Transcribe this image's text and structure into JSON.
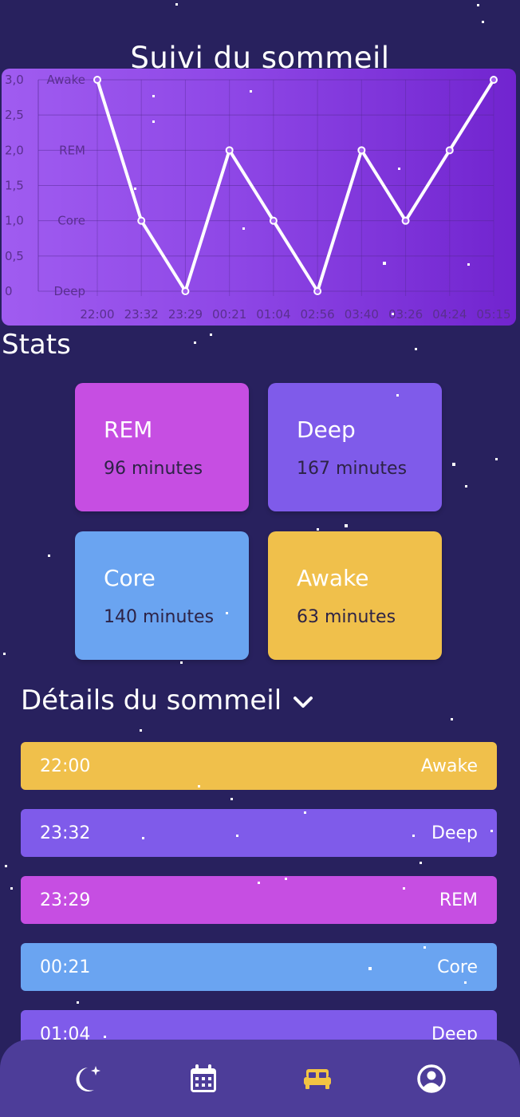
{
  "header": {
    "title": "Suivi du sommeil"
  },
  "chart_data": {
    "type": "line",
    "x": [
      "22:00",
      "23:32",
      "23:29",
      "00:21",
      "01:04",
      "02:56",
      "03:40",
      "03:26",
      "04:24",
      "05:15"
    ],
    "values": [
      3,
      1,
      0,
      2,
      1,
      0,
      2,
      1,
      2,
      3
    ],
    "y_ticks": [
      "0",
      "0,5",
      "1,0",
      "1,5",
      "2,0",
      "2,5",
      "3,0"
    ],
    "y_category_labels": [
      "Deep",
      "Core",
      "REM",
      "Awake"
    ],
    "ylim": [
      0,
      3
    ],
    "grid": true,
    "colors": {
      "line": "#ffffff",
      "background_start": "#a05cf0",
      "background_end": "#7124cf"
    }
  },
  "stats": {
    "title": "Stats",
    "cards": [
      {
        "name": "REM",
        "value": "96 minutes",
        "color": "#c64ee2"
      },
      {
        "name": "Deep",
        "value": "167 minutes",
        "color": "#7f5bea"
      },
      {
        "name": "Core",
        "value": "140 minutes",
        "color": "#6aa4f1"
      },
      {
        "name": "Awake",
        "value": "63 minutes",
        "color": "#f0c04b"
      }
    ]
  },
  "details": {
    "title": "Détails du sommeil",
    "rows": [
      {
        "time": "22:00",
        "stage": "Awake",
        "color": "#f0c04b"
      },
      {
        "time": "23:32",
        "stage": "Deep",
        "color": "#7f5bea"
      },
      {
        "time": "23:29",
        "stage": "REM",
        "color": "#c64ee2"
      },
      {
        "time": "00:21",
        "stage": "Core",
        "color": "#6aa4f1"
      },
      {
        "time": "01:04",
        "stage": "Deep",
        "color": "#7f5bea"
      }
    ]
  },
  "nav": {
    "items": [
      {
        "icon": "moon-star-icon",
        "active": false
      },
      {
        "icon": "calendar-icon",
        "active": false
      },
      {
        "icon": "bed-icon",
        "active": true
      },
      {
        "icon": "user-circle-icon",
        "active": false
      }
    ],
    "active_color": "#f3c443",
    "inactive_color": "#ffffff"
  }
}
